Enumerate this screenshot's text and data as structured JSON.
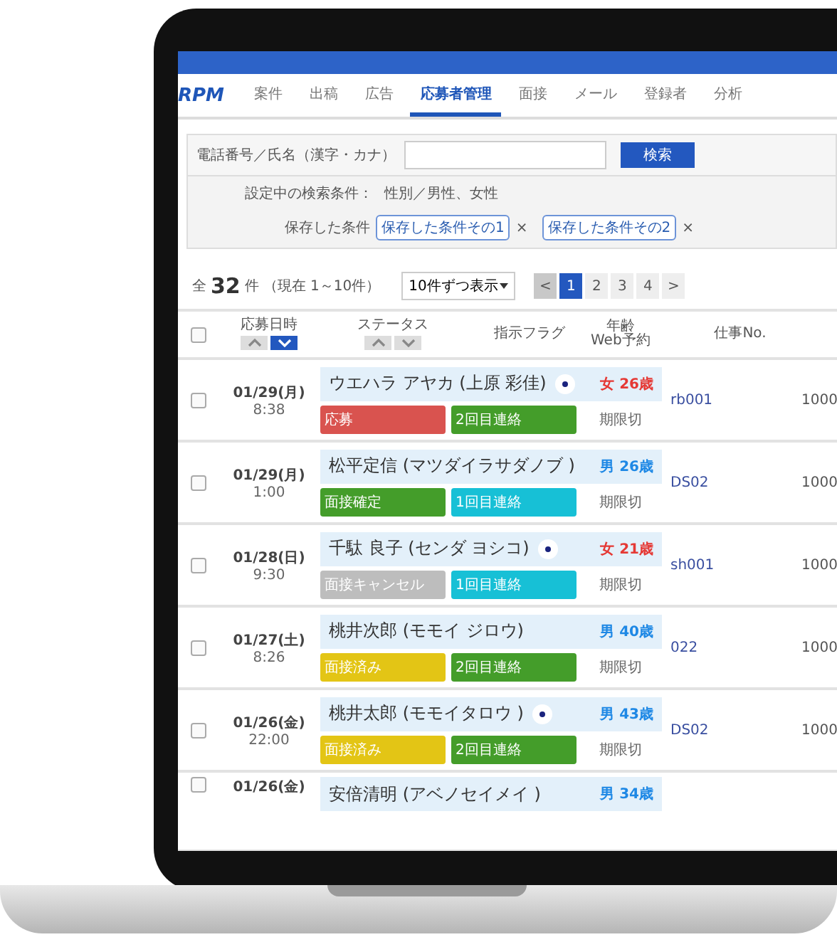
{
  "app": {
    "logo": "RPM"
  },
  "nav": [
    {
      "label": "案件",
      "selected": false
    },
    {
      "label": "出稿",
      "selected": false
    },
    {
      "label": "広告",
      "selected": false
    },
    {
      "label": "応募者管理",
      "selected": true
    },
    {
      "label": "面接",
      "selected": false
    },
    {
      "label": "メール",
      "selected": false
    },
    {
      "label": "登録者",
      "selected": false
    },
    {
      "label": "分析",
      "selected": false
    }
  ],
  "search": {
    "label": "電話番号／氏名（漢字・カナ）",
    "button": "検索",
    "conditions_label": "設定中の検索条件：",
    "conditions": "性別／男性、女性",
    "saved_label": "保存した条件",
    "saved": [
      {
        "label": "保存した条件その1",
        "remove": "×"
      },
      {
        "label": "保存した条件その2",
        "remove": "×"
      }
    ]
  },
  "summary": {
    "prefix": "全",
    "count": "32",
    "unit": "件",
    "range": "（現在 1～10件）",
    "per_page": "10件ずつ表示"
  },
  "pagination": [
    {
      "label": "<",
      "kind": "prev",
      "selected": false
    },
    {
      "label": "1",
      "kind": "page",
      "selected": true
    },
    {
      "label": "2",
      "kind": "page",
      "selected": false
    },
    {
      "label": "3",
      "kind": "page",
      "selected": false
    },
    {
      "label": "4",
      "kind": "page",
      "selected": false
    },
    {
      "label": ">",
      "kind": "next",
      "selected": false
    }
  ],
  "table": {
    "select_all": {
      "checked": false
    },
    "columns": [
      {
        "label": "応募日時",
        "sort": [
          {
            "kind": "up",
            "selected": false
          },
          {
            "kind": "down",
            "selected": true
          }
        ]
      },
      {
        "label": "ステータス",
        "sort": [
          {
            "kind": "up",
            "selected": false
          },
          {
            "kind": "down",
            "selected": false
          }
        ]
      },
      {
        "label": "指示フラグ"
      },
      {
        "lines": [
          "年齢",
          "Web予約"
        ]
      },
      {
        "label": "仕事No."
      }
    ],
    "rows": [
      {
        "date": "01/29(月)",
        "time": "8:38",
        "name": "ウエハラ アヤカ (上原 彩佳)",
        "checked": false,
        "flagged": true,
        "age": "女 26歳",
        "color": "#e53935",
        "tags": [
          {
            "label": "応募",
            "color": "#d9534f"
          },
          {
            "label": "2回目連絡",
            "color": "#449d2a"
          }
        ],
        "web": "期限切",
        "job": "rb001",
        "column_6": "1000"
      },
      {
        "date": "01/29(月)",
        "time": "1:00",
        "name": "松平定信 (マツダイラサダノブ )",
        "checked": false,
        "flagged": false,
        "age": "男 26歳",
        "color": "#1e88e5",
        "tags": [
          {
            "label": "面接確定",
            "color": "#449d2a"
          },
          {
            "label": "1回目連絡",
            "color": "#17c0d6"
          }
        ],
        "web": "期限切",
        "job": "DS02",
        "column_6": "1000"
      },
      {
        "date": "01/28(日)",
        "time": "9:30",
        "name": "千駄 良子 (センダ ヨシコ)",
        "checked": false,
        "flagged": true,
        "age": "女 21歳",
        "color": "#e53935",
        "tags": [
          {
            "label": "面接キャンセル",
            "color": "#bdbdbd"
          },
          {
            "label": "1回目連絡",
            "color": "#17c0d6"
          }
        ],
        "web": "期限切",
        "job": "sh001",
        "column_6": "1000"
      },
      {
        "date": "01/27(土)",
        "time": "8:26",
        "name": "桃井次郎 (モモイ ジロウ)",
        "checked": false,
        "flagged": false,
        "age": "男 40歳",
        "color": "#1e88e5",
        "tags": [
          {
            "label": "面接済み",
            "color": "#e3c515"
          },
          {
            "label": "2回目連絡",
            "color": "#449d2a"
          }
        ],
        "web": "期限切",
        "job": "022",
        "column_6": "1000"
      },
      {
        "date": "01/26(金)",
        "time": "22:00",
        "name": "桃井太郎 (モモイタロウ )",
        "checked": false,
        "flagged": true,
        "age": "男 43歳",
        "color": "#1e88e5",
        "tags": [
          {
            "label": "面接済み",
            "color": "#e3c515"
          },
          {
            "label": "2回目連絡",
            "color": "#449d2a"
          }
        ],
        "web": "期限切",
        "job": "DS02",
        "column_6": "1000"
      },
      {
        "date": "01/26(金)",
        "name": "安倍清明 (アベノセイメイ )",
        "checked": false,
        "flagged": false,
        "age": "男 34歳",
        "color": "#1e88e5",
        "tags": []
      }
    ]
  }
}
